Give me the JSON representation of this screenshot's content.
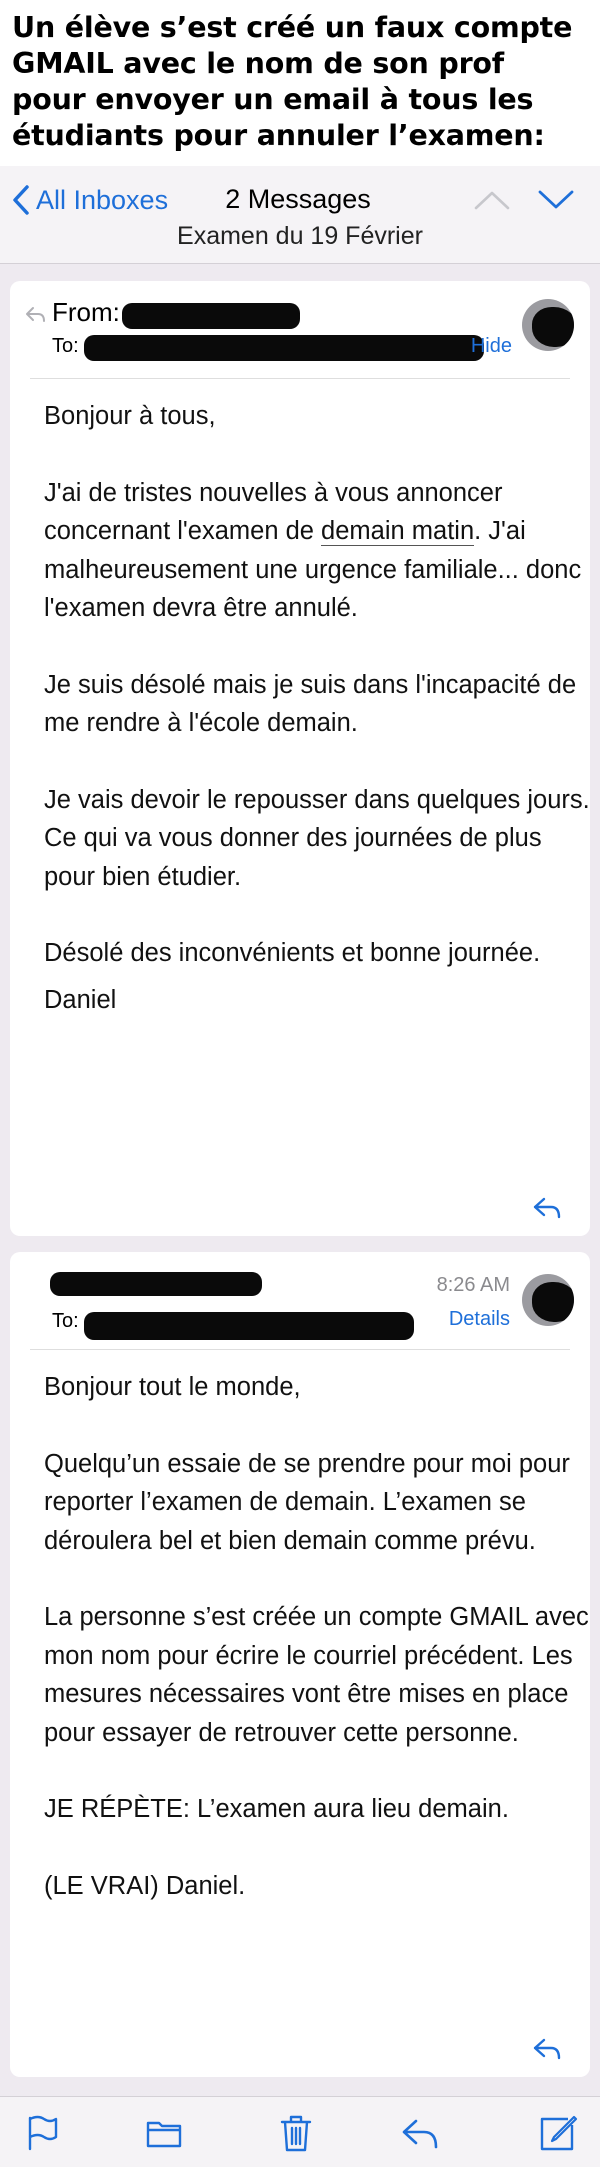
{
  "caption": {
    "lines": [
      "Un élève s’est créé un faux compte",
      "GMAIL avec le nom de son prof",
      "pour envoyer un email à tous les",
      "étudiants pour annuler l’examen:"
    ]
  },
  "navbar": {
    "back_label": "All Inboxes",
    "title": "2 Messages",
    "subject": "Examen du 19 Février"
  },
  "message1": {
    "from_label": "From:",
    "to_label": "To:",
    "hide_label": "Hide",
    "paragraphs": [
      {
        "before": "Bonjour à tous,",
        "underline": "",
        "after": ""
      },
      {
        "before": "J'ai de tristes nouvelles à vous annoncer concernant l'examen de ",
        "underline": "demain matin",
        "after": ". J'ai malheureusement une urgence familiale... donc l'examen devra être annulé."
      },
      {
        "before": "Je suis désolé mais je suis dans l'incapacité de me rendre à l'école demain.",
        "underline": "",
        "after": ""
      },
      {
        "before": "Je vais devoir le repousser dans quelques jours. Ce qui va vous donner des journées de plus",
        "underline": "",
        "after": ""
      },
      {
        "before": "pour bien étudier.",
        "underline": "",
        "after": ""
      },
      {
        "before": "Désolé des inconvénients et bonne journée.",
        "underline": "",
        "after": ""
      },
      {
        "before": "Daniel",
        "underline": "",
        "after": ""
      }
    ]
  },
  "message2": {
    "time": "8:26 AM",
    "to_label": "To:",
    "details_label": "Details",
    "paragraphs": [
      "Bonjour tout le monde,",
      "Quelqu’un essaie de se prendre pour moi pour reporter l’examen de demain. L’examen se déroulera bel et bien demain comme prévu.",
      "La personne s’est créée un compte GMAIL avec mon nom pour écrire le courriel précédent. Les mesures nécessaires vont être mises en place pour essayer de retrouver cette personne.",
      "JE RÉPÈTE: L’examen aura lieu demain.",
      "(LE VRAI) Daniel."
    ]
  },
  "toolbar": {
    "icons": [
      "flag-icon",
      "folder-icon",
      "trash-icon",
      "reply-icon",
      "compose-icon"
    ]
  },
  "colors": {
    "accent": "#1e6fd9",
    "background": "#eeeaf0",
    "redaction": "#0a0a0a"
  }
}
